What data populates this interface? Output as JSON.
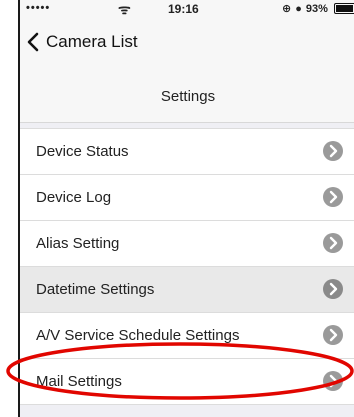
{
  "status_bar": {
    "signal": "•••••",
    "wifi_icon": "wifi-icon",
    "time": "19:16",
    "battery_text": "93%",
    "battery_level": 0.93
  },
  "nav": {
    "back_label": "Camera List"
  },
  "page": {
    "title": "Settings"
  },
  "settings_items": [
    {
      "label": "Device Status"
    },
    {
      "label": "Device Log"
    },
    {
      "label": "Alias Setting"
    },
    {
      "label": "Datetime Settings"
    },
    {
      "label": "A/V Service Schedule Settings"
    },
    {
      "label": "Mail Settings"
    }
  ],
  "colors": {
    "annotation": "#e10600",
    "chevron_circle": "#9a9a9a",
    "background": "#efeff4"
  }
}
